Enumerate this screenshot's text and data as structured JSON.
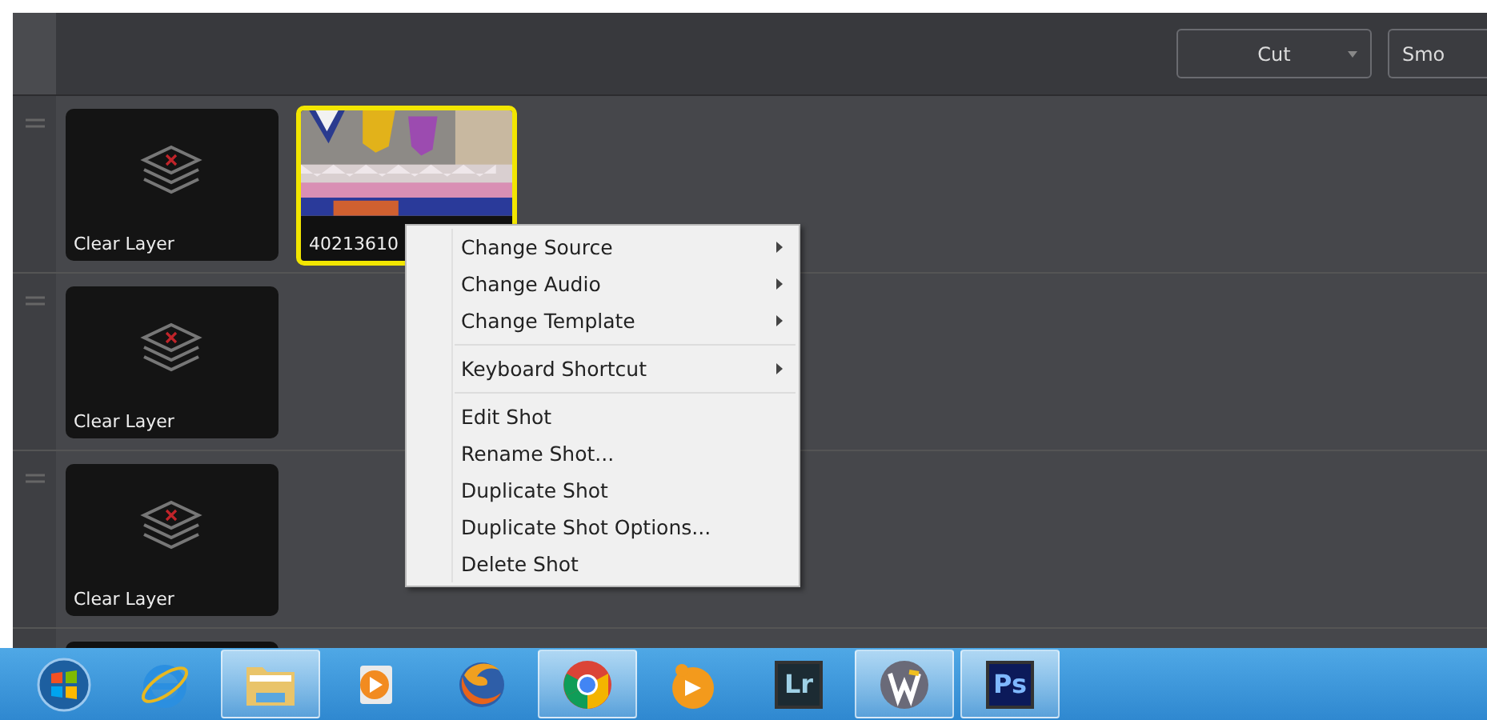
{
  "header": {
    "buttons": [
      {
        "label": "Cut",
        "dropdown": true
      },
      {
        "label": "Smo",
        "dropdown": false
      }
    ]
  },
  "layers": [
    {
      "shots": [
        {
          "kind": "clear",
          "label": "Clear Layer",
          "selected": false
        },
        {
          "kind": "picture",
          "label": "40213610",
          "selected": true
        }
      ]
    },
    {
      "shots": [
        {
          "kind": "clear",
          "label": "Clear Layer",
          "selected": false
        }
      ]
    },
    {
      "shots": [
        {
          "kind": "clear",
          "label": "Clear Layer",
          "selected": false
        }
      ]
    }
  ],
  "context_menu": {
    "groups": [
      [
        {
          "label": "Change Source",
          "submenu": true
        },
        {
          "label": "Change Audio",
          "submenu": true
        },
        {
          "label": "Change Template",
          "submenu": true
        }
      ],
      [
        {
          "label": "Keyboard Shortcut",
          "submenu": true
        }
      ],
      [
        {
          "label": "Edit Shot",
          "submenu": false
        },
        {
          "label": "Rename Shot...",
          "submenu": false
        },
        {
          "label": "Duplicate Shot",
          "submenu": false
        },
        {
          "label": "Duplicate Shot Options...",
          "submenu": false
        },
        {
          "label": "Delete Shot",
          "submenu": false
        }
      ]
    ]
  },
  "taskbar": {
    "apps": [
      {
        "kind": "start",
        "running": false
      },
      {
        "kind": "ie",
        "running": false
      },
      {
        "kind": "folder",
        "running": true
      },
      {
        "kind": "player",
        "running": false
      },
      {
        "kind": "firefox",
        "running": false
      },
      {
        "kind": "chrome",
        "running": true
      },
      {
        "kind": "orange",
        "running": false
      },
      {
        "kind": "tile",
        "text": "Lr",
        "running": false
      },
      {
        "kind": "wirecast",
        "running": true
      },
      {
        "kind": "tile",
        "text": "Ps",
        "running": true
      }
    ]
  }
}
